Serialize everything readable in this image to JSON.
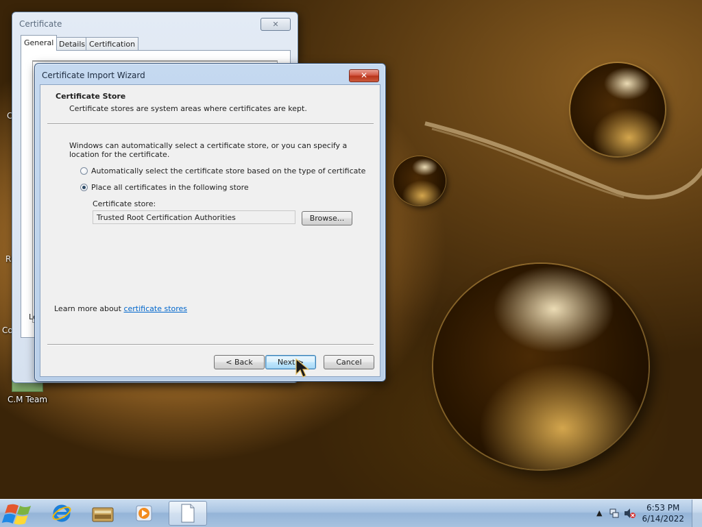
{
  "desktop": {
    "partial_labels": [
      "C",
      "R",
      "Co"
    ],
    "icon": {
      "label": "C.M Team",
      "icon": "document-folder-icon"
    }
  },
  "certificate_window": {
    "title": "Certificate",
    "close_label": "✕",
    "tabs": [
      "General",
      "Details",
      "Certification Path"
    ],
    "active_tab": "General",
    "partial_text": "Le"
  },
  "wizard": {
    "title": "Certificate Import Wizard",
    "close_label": "✕",
    "header": {
      "title": "Certificate Store",
      "description": "Certificate stores are system areas where certificates are kept."
    },
    "body_text": "Windows can automatically select a certificate store, or you can specify a location for the certificate.",
    "options": [
      {
        "label": "Automatically select the certificate store based on the type of certificate",
        "checked": false
      },
      {
        "label": "Place all certificates in the following store",
        "checked": true
      }
    ],
    "store_label": "Certificate store:",
    "store_value": "Trusted Root Certification Authorities",
    "browse_label": "Browse...",
    "learn_more_prefix": "Learn more about ",
    "learn_more_link": "certificate stores",
    "buttons": {
      "back": "< Back",
      "next": "Next >",
      "cancel": "Cancel"
    }
  },
  "taskbar": {
    "pinned": [
      {
        "name": "internet-explorer-icon"
      },
      {
        "name": "file-explorer-icon"
      },
      {
        "name": "media-player-icon"
      },
      {
        "name": "document-icon",
        "active": true
      }
    ],
    "tray": {
      "icons": [
        "show-hidden-icons-arrow",
        "network-icon",
        "volume-muted-icon"
      ]
    },
    "clock": {
      "time": "6:53 PM",
      "date": "6/14/2022"
    }
  }
}
